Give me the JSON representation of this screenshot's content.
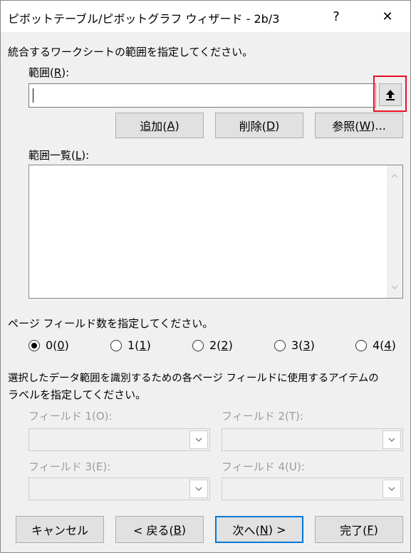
{
  "window": {
    "title": "ピボットテーブル/ピボットグラフ ウィザード - 2b/3",
    "help_glyph": "?",
    "close_glyph": "✕"
  },
  "instruction": "統合するワークシートの範囲を指定してください。",
  "range": {
    "label_pre": "範囲(",
    "label_key": "R",
    "label_post": "):",
    "value": ""
  },
  "buttons": {
    "add": {
      "pre": "追加(",
      "key": "A",
      "post": ")"
    },
    "delete": {
      "pre": "削除(",
      "key": "D",
      "post": ")"
    },
    "browse": {
      "pre": "参照(",
      "key": "W",
      "post": ")..."
    }
  },
  "range_list": {
    "label_pre": "範囲一覧(",
    "label_key": "L",
    "label_post": "):",
    "items": []
  },
  "page_fields": {
    "prompt": "ページ フィールド数を指定してください。",
    "options": [
      {
        "pre": "0(",
        "key": "0",
        "post": ")",
        "selected": true
      },
      {
        "pre": "1(",
        "key": "1",
        "post": ")",
        "selected": false
      },
      {
        "pre": "2(",
        "key": "2",
        "post": ")",
        "selected": false
      },
      {
        "pre": "3(",
        "key": "3",
        "post": ")",
        "selected": false
      },
      {
        "pre": "4(",
        "key": "4",
        "post": ")",
        "selected": false
      }
    ]
  },
  "labels_prompt_line1": "選択したデータ範囲を識別するための各ページ フィールドに使用するアイテムの",
  "labels_prompt_line2": "ラベルを指定してください。",
  "fields": [
    {
      "label": "フィールド 1(O):",
      "value": ""
    },
    {
      "label": "フィールド 2(T):",
      "value": ""
    },
    {
      "label": "フィールド 3(E):",
      "value": ""
    },
    {
      "label": "フィールド 4(U):",
      "value": ""
    }
  ],
  "footer": {
    "cancel": "キャンセル",
    "back": {
      "pre": "< 戻る(",
      "key": "B",
      "post": ")"
    },
    "next": {
      "pre": "次へ(",
      "key": "N",
      "post": ") >"
    },
    "finish": {
      "pre": "完了(",
      "key": "F",
      "post": ")"
    }
  },
  "icons": {
    "collapse": "collapse-dialog-icon",
    "help": "help-icon",
    "close": "close-icon",
    "dropdown": "chevron-down-icon"
  }
}
